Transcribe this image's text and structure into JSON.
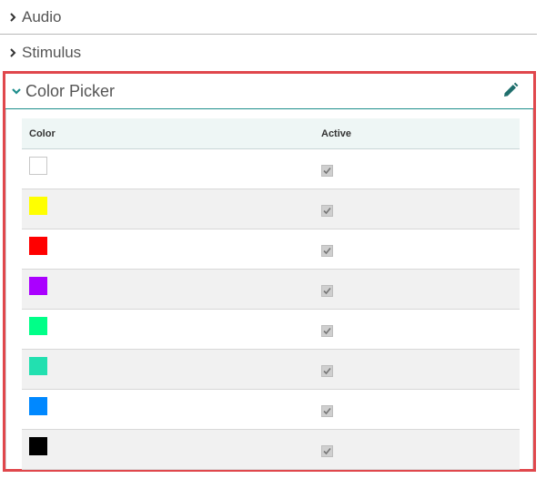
{
  "sections": {
    "audio": {
      "label": "Audio"
    },
    "stimulus": {
      "label": "Stimulus"
    }
  },
  "panel": {
    "title": "Color Picker",
    "edit_icon": "pencil-icon",
    "accent_color": "#1e8e8c",
    "highlight_border_color": "#e0474c"
  },
  "table": {
    "headers": {
      "color": "Color",
      "active": "Active"
    },
    "rows": [
      {
        "color": "#ffffff",
        "active": true
      },
      {
        "color": "#ffff00",
        "active": true
      },
      {
        "color": "#ff0000",
        "active": true
      },
      {
        "color": "#aa00ff",
        "active": true
      },
      {
        "color": "#00ff88",
        "active": true
      },
      {
        "color": "#22e0b0",
        "active": true
      },
      {
        "color": "#0088ff",
        "active": true
      },
      {
        "color": "#000000",
        "active": true
      }
    ]
  }
}
